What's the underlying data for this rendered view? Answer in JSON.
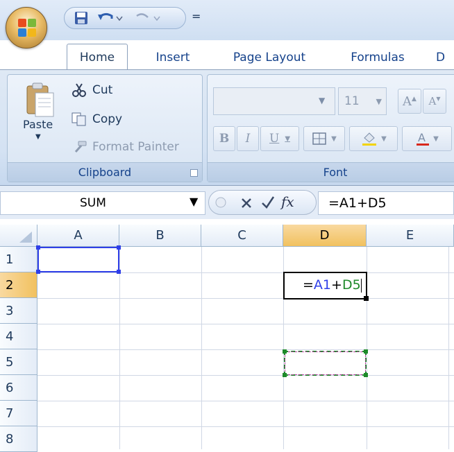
{
  "qat": {
    "save": "save-icon",
    "undo": "undo-icon",
    "redo": "redo-icon",
    "customize_symbol": "="
  },
  "tabs": [
    "Home",
    "Insert",
    "Page Layout",
    "Formulas",
    "D"
  ],
  "ribbon": {
    "clipboard": {
      "paste_label": "Paste",
      "cut_label": "Cut",
      "copy_label": "Copy",
      "format_painter_label": "Format Painter",
      "group_label": "Clipboard"
    },
    "font": {
      "font_name": "",
      "font_size": "11",
      "bold": "B",
      "italic": "I",
      "underline": "U",
      "group_label": "Font"
    }
  },
  "formula_bar": {
    "name_box": "SUM",
    "fx_label": "fx",
    "formula": "=A1+D5"
  },
  "grid": {
    "columns": [
      "A",
      "B",
      "C",
      "D",
      "E"
    ],
    "rows": [
      "1",
      "2",
      "3",
      "4",
      "5",
      "6",
      "7",
      "8"
    ],
    "active_column": "D",
    "active_row": "2",
    "cell_d2": {
      "eq": "=",
      "ref1": "A1",
      "plus": "+",
      "ref2": "D5"
    }
  },
  "colors": {
    "ref_a1": "#2f3fe8",
    "ref_d5": "#1e8a2a",
    "active_header": "#f1c15f"
  }
}
